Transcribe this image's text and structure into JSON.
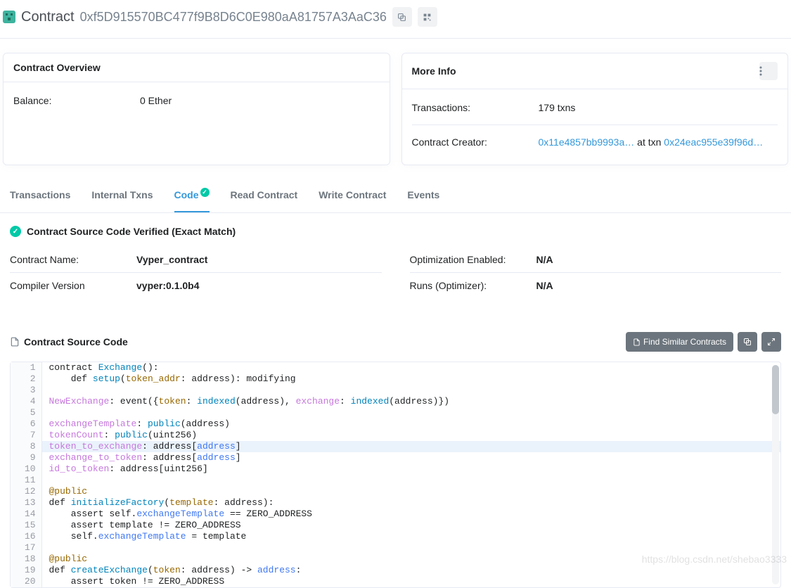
{
  "header": {
    "title": "Contract",
    "address": "0xf5D915570BC477f9B8D6C0E980aA81757A3AaC36"
  },
  "overview": {
    "title": "Contract Overview",
    "balance_label": "Balance:",
    "balance_value": "0 Ether"
  },
  "moreinfo": {
    "title": "More Info",
    "txns_label": "Transactions:",
    "txns_value": "179 txns",
    "creator_label": "Contract Creator:",
    "creator_addr": "0x11e4857bb9993a…",
    "at_txn": " at txn ",
    "txn_hash": "0x24eac955e39f96d…"
  },
  "tabs": [
    "Transactions",
    "Internal Txns",
    "Code",
    "Read Contract",
    "Write Contract",
    "Events"
  ],
  "active_tab_index": 2,
  "verified_text": "Contract Source Code Verified (Exact Match)",
  "meta": {
    "contract_name_label": "Contract Name:",
    "contract_name": "Vyper_contract",
    "compiler_label": "Compiler Version",
    "compiler_value": "vyper:0.1.0b4",
    "opt_label": "Optimization Enabled:",
    "opt_value": "N/A",
    "runs_label": "Runs (Optimizer):",
    "runs_value": "N/A"
  },
  "source": {
    "title": "Contract Source Code",
    "find_label": "Find Similar Contracts"
  },
  "code_lines": 20,
  "highlight_line": 8,
  "watermark": "https://blog.csdn.net/shebao3333"
}
